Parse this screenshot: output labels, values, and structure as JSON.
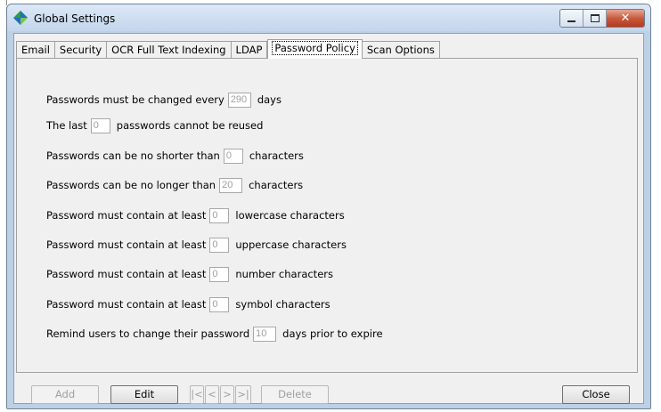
{
  "window": {
    "title": "Global Settings",
    "icon": "diamond-app-icon"
  },
  "caption_buttons": {
    "minimize": "minimize-icon",
    "maximize": "maximize-icon",
    "close": "✕"
  },
  "tabs": [
    {
      "label": "Email"
    },
    {
      "label": "Security"
    },
    {
      "label": "OCR Full Text Indexing"
    },
    {
      "label": "LDAP"
    },
    {
      "label": "Password Policy",
      "active": true
    },
    {
      "label": "Scan Options"
    }
  ],
  "policy": {
    "change_every": {
      "before": "Passwords must be changed every",
      "value": "290",
      "after": "days"
    },
    "last_n": {
      "before": "The last",
      "value": "0",
      "after": "passwords cannot be reused"
    },
    "min_length": {
      "before": "Passwords can be no shorter than",
      "value": "0",
      "after": "characters"
    },
    "max_length": {
      "before": "Passwords can be no longer than",
      "value": "20",
      "after": "characters"
    },
    "lowercase": {
      "before": "Password must contain at least",
      "value": "0",
      "after": "lowercase characters"
    },
    "uppercase": {
      "before": "Password must contain at least",
      "value": "0",
      "after": "uppercase characters"
    },
    "numbers": {
      "before": "Password must contain at least",
      "value": "0",
      "after": "number characters"
    },
    "symbols": {
      "before": "Password must contain at least",
      "value": "0",
      "after": "symbol characters"
    },
    "remind": {
      "before": "Remind users to change their password",
      "value": "10",
      "after": "days prior to expire"
    }
  },
  "buttons": {
    "add": "Add",
    "edit": "Edit",
    "first": "|<",
    "prev": "<",
    "next": ">",
    "last": ">|",
    "delete": "Delete",
    "close": "Close"
  },
  "colors": {
    "titlebar": "#c3d6ec",
    "close_button": "#c75a3d",
    "app_icon_blue": "#1f6fc5",
    "app_icon_green": "#2da03a"
  }
}
